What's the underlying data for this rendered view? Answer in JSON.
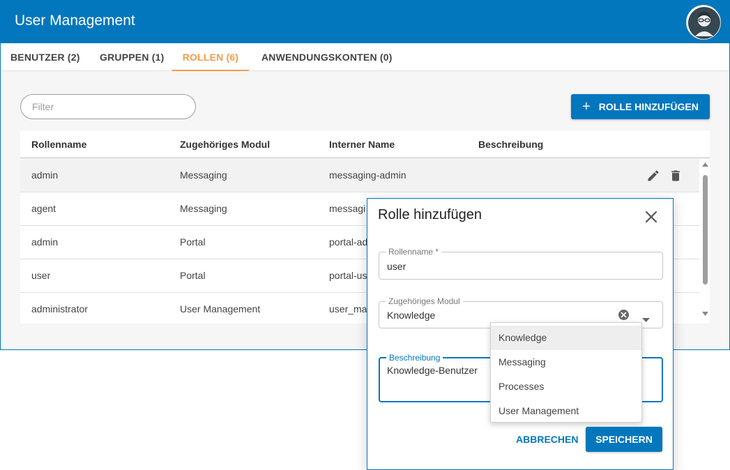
{
  "header": {
    "title": "User Management",
    "avatar": "user-avatar-icon"
  },
  "tabs": [
    {
      "label": "BENUTZER (2)"
    },
    {
      "label": "GRUPPEN (1)"
    },
    {
      "label": "ROLLEN (6)",
      "active": true
    },
    {
      "label": "ANWENDUNGSKONTEN (0)"
    }
  ],
  "toolbar": {
    "filter_placeholder": "Filter",
    "add_label": "ROLLE HINZUFÜGEN",
    "add_icon": "plus-icon"
  },
  "table": {
    "columns": [
      "Rollenname",
      "Zugehöriges Modul",
      "Interner Name",
      "Beschreibung"
    ],
    "rows": [
      {
        "name": "admin",
        "module": "Messaging",
        "internal": "messaging-admin",
        "desc": ""
      },
      {
        "name": "agent",
        "module": "Messaging",
        "internal": "messagi",
        "desc": ""
      },
      {
        "name": "admin",
        "module": "Portal",
        "internal": "portal-ad",
        "desc": ""
      },
      {
        "name": "user",
        "module": "Portal",
        "internal": "portal-us",
        "desc": ""
      },
      {
        "name": "administrator",
        "module": "User Management",
        "internal": "user_ma",
        "desc": ""
      }
    ]
  },
  "dialog": {
    "title": "Rolle hinzufügen",
    "rolename_label": "Rollenname *",
    "rolename_value": "user",
    "module_label": "Zugehöriges Modul",
    "module_value": "Knowledge",
    "desc_label": "Beschreibung",
    "desc_value": "Knowledge-Benutzer",
    "cancel_label": "ABBRECHEN",
    "save_label": "SPEICHERN"
  },
  "dropdown": {
    "options": [
      "Knowledge",
      "Messaging",
      "Processes",
      "User Management"
    ],
    "selected": "Knowledge"
  },
  "colors": {
    "primary": "#0277bd",
    "active_tab": "#f39c4d"
  }
}
